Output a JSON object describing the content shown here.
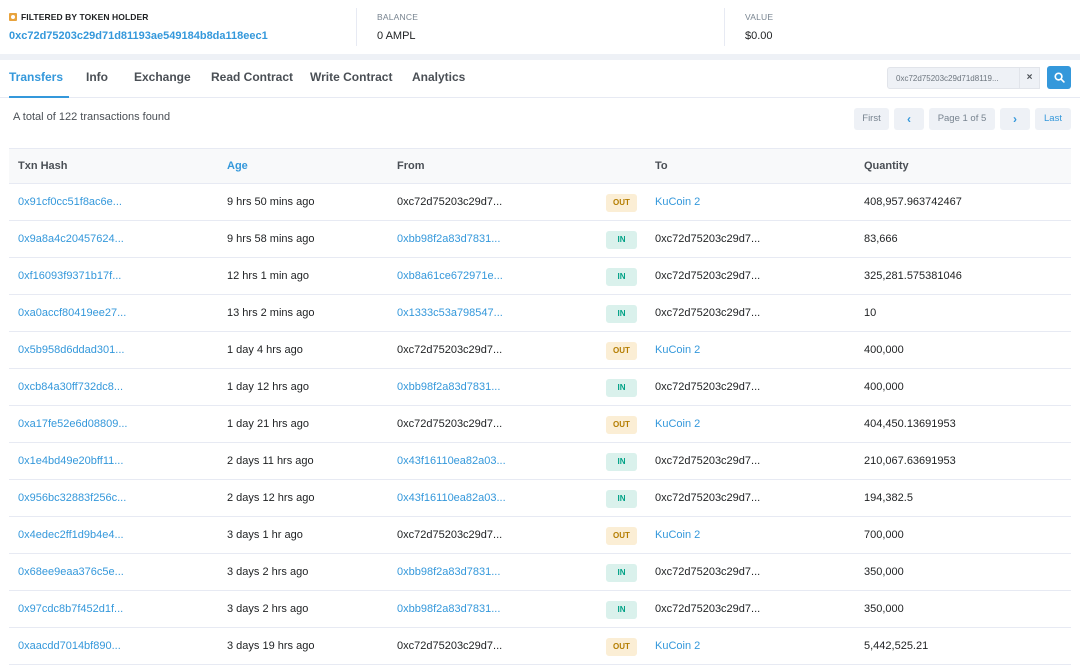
{
  "filter": {
    "title": "FILTERED BY TOKEN HOLDER",
    "address": "0xc72d75203c29d71d81193ae549184b8da118eec1",
    "balance_label": "BALANCE",
    "balance_value": "0 AMPL",
    "value_label": "VALUE",
    "value_value": "$0.00"
  },
  "tabs": [
    "Transfers",
    "Info",
    "Exchange",
    "Read Contract",
    "Write Contract",
    "Analytics"
  ],
  "search": {
    "value": "0xc72d75203c29d71d8119...",
    "clear": "×"
  },
  "summary": "A total of 122 transactions found",
  "pager": {
    "first": "First",
    "prev": "‹",
    "page": "Page 1 of 5",
    "next": "›",
    "last": "Last"
  },
  "table": {
    "headers": {
      "txn": "Txn Hash",
      "age": "Age",
      "from": "From",
      "to": "To",
      "qty": "Quantity"
    },
    "rows": [
      {
        "txn": "0x91cf0cc51f8ac6e...",
        "age": "9 hrs 50 mins ago",
        "from": "0xc72d75203c29d7...",
        "dir": "OUT",
        "to": "KuCoin 2",
        "qty": "408,957.963742467"
      },
      {
        "txn": "0x9a8a4c20457624...",
        "age": "9 hrs 58 mins ago",
        "from": "0xbb98f2a83d7831...",
        "dir": "IN",
        "to": "0xc72d75203c29d7...",
        "qty": "83,666"
      },
      {
        "txn": "0xf16093f9371b17f...",
        "age": "12 hrs 1 min ago",
        "from": "0xb8a61ce672971e...",
        "dir": "IN",
        "to": "0xc72d75203c29d7...",
        "qty": "325,281.575381046"
      },
      {
        "txn": "0xa0accf80419ee27...",
        "age": "13 hrs 2 mins ago",
        "from": "0x1333c53a798547...",
        "dir": "IN",
        "to": "0xc72d75203c29d7...",
        "qty": "10"
      },
      {
        "txn": "0x5b958d6ddad301...",
        "age": "1 day 4 hrs ago",
        "from": "0xc72d75203c29d7...",
        "dir": "OUT",
        "to": "KuCoin 2",
        "qty": "400,000"
      },
      {
        "txn": "0xcb84a30ff732dc8...",
        "age": "1 day 12 hrs ago",
        "from": "0xbb98f2a83d7831...",
        "dir": "IN",
        "to": "0xc72d75203c29d7...",
        "qty": "400,000"
      },
      {
        "txn": "0xa17fe52e6d08809...",
        "age": "1 day 21 hrs ago",
        "from": "0xc72d75203c29d7...",
        "dir": "OUT",
        "to": "KuCoin 2",
        "qty": "404,450.13691953"
      },
      {
        "txn": "0x1e4bd49e20bff11...",
        "age": "2 days 11 hrs ago",
        "from": "0x43f16110ea82a03...",
        "dir": "IN",
        "to": "0xc72d75203c29d7...",
        "qty": "210,067.63691953"
      },
      {
        "txn": "0x956bc32883f256c...",
        "age": "2 days 12 hrs ago",
        "from": "0x43f16110ea82a03...",
        "dir": "IN",
        "to": "0xc72d75203c29d7...",
        "qty": "194,382.5"
      },
      {
        "txn": "0x4edec2ff1d9b4e4...",
        "age": "3 days 1 hr ago",
        "from": "0xc72d75203c29d7...",
        "dir": "OUT",
        "to": "KuCoin 2",
        "qty": "700,000"
      },
      {
        "txn": "0x68ee9eaa376c5e...",
        "age": "3 days 2 hrs ago",
        "from": "0xbb98f2a83d7831...",
        "dir": "IN",
        "to": "0xc72d75203c29d7...",
        "qty": "350,000"
      },
      {
        "txn": "0x97cdc8b7f452d1f...",
        "age": "3 days 2 hrs ago",
        "from": "0xbb98f2a83d7831...",
        "dir": "IN",
        "to": "0xc72d75203c29d7...",
        "qty": "350,000"
      },
      {
        "txn": "0xaacdd7014bf890...",
        "age": "3 days 19 hrs ago",
        "from": "0xc72d75203c29d7...",
        "dir": "OUT",
        "to": "KuCoin 2",
        "qty": "5,442,525.21"
      }
    ]
  },
  "colors": {
    "accent": "#3498db",
    "out_badge_bg": "#fbeed5",
    "out_badge_fg": "#b47d00",
    "in_badge_bg": "#daf1ec",
    "in_badge_fg": "#00a186"
  },
  "icons": {
    "filter": "tag-icon",
    "search": "search-icon",
    "clear": "close-icon"
  }
}
